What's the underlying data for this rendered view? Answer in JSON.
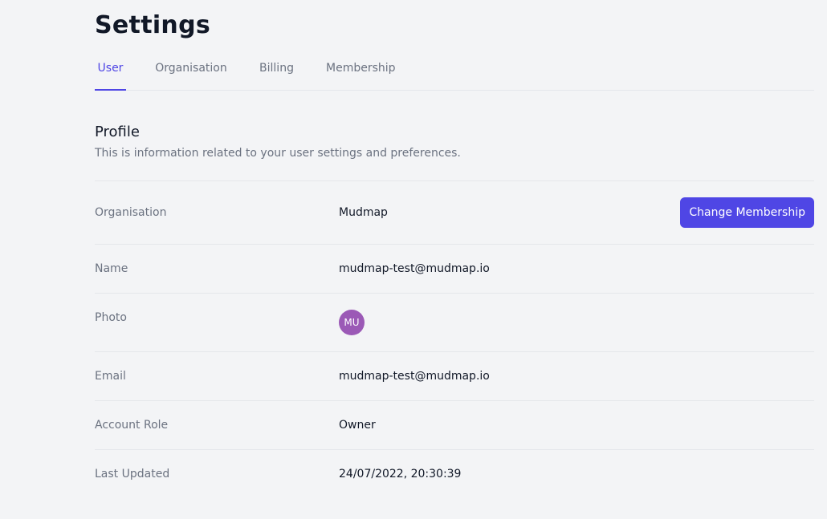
{
  "page": {
    "title": "Settings"
  },
  "tabs": [
    {
      "label": "User",
      "active": true
    },
    {
      "label": "Organisation",
      "active": false
    },
    {
      "label": "Billing",
      "active": false
    },
    {
      "label": "Membership",
      "active": false
    }
  ],
  "profile": {
    "heading": "Profile",
    "description": "This is information related to your user settings and preferences.",
    "rows": {
      "organisation": {
        "label": "Organisation",
        "value": "Mudmap",
        "action_label": "Change Membership"
      },
      "name": {
        "label": "Name",
        "value": "mudmap-test@mudmap.io"
      },
      "photo": {
        "label": "Photo",
        "avatar_initials": "MU",
        "avatar_color": "#9b59b6"
      },
      "email": {
        "label": "Email",
        "value": "mudmap-test@mudmap.io"
      },
      "account_role": {
        "label": "Account Role",
        "value": "Owner"
      },
      "last_updated": {
        "label": "Last Updated",
        "value": "24/07/2022, 20:30:39"
      }
    }
  },
  "colors": {
    "accent": "#4f46e5",
    "background": "#f3f4f6",
    "divider": "#e5e7eb",
    "text_primary": "#111827",
    "text_muted": "#6b7280"
  }
}
